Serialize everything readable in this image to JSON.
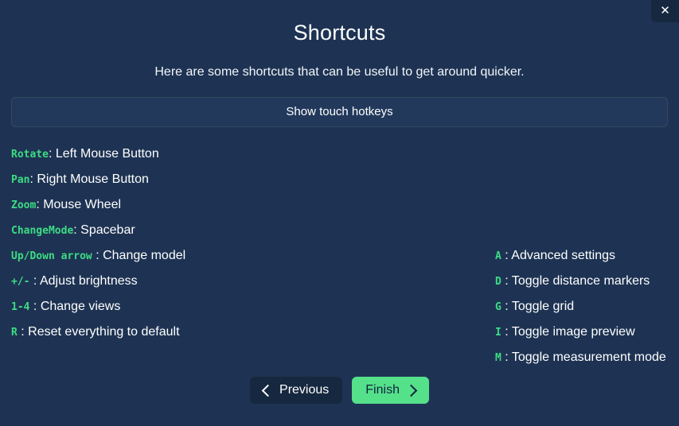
{
  "dialog": {
    "title": "Shortcuts",
    "subtitle": "Here are some shortcuts that can be useful to get around quicker.",
    "close_label": "✕"
  },
  "touch_button": {
    "label": "Show touch hotkeys"
  },
  "colors": {
    "background": "#1e3353",
    "key_green": "#3ddc84",
    "finish_green": "#55e08a",
    "button_dark": "#16283f",
    "panel": "#22395c"
  },
  "shortcuts_left": [
    {
      "key": "Rotate",
      "sep": ": ",
      "desc": "Left Mouse Button"
    },
    {
      "key": "Pan",
      "sep": ": ",
      "desc": "Right Mouse Button"
    },
    {
      "key": "Zoom",
      "sep": ": ",
      "desc": "Mouse Wheel"
    },
    {
      "key": "ChangeMode",
      "sep": ": ",
      "desc": "Spacebar"
    },
    {
      "key": "Up/Down arrow",
      "sep": " : ",
      "desc": "Change model"
    },
    {
      "key": "+/-",
      "sep": " : ",
      "desc": "Adjust brightness"
    },
    {
      "key": "1-4",
      "sep": " : ",
      "desc": "Change views"
    },
    {
      "key": "R",
      "sep": " : ",
      "desc": "Reset everything to default"
    }
  ],
  "shortcuts_right": [
    {
      "key": "A",
      "sep": " : ",
      "desc": "Advanced settings"
    },
    {
      "key": "D",
      "sep": " : ",
      "desc": "Toggle distance markers"
    },
    {
      "key": "G",
      "sep": " : ",
      "desc": "Toggle grid"
    },
    {
      "key": "I",
      "sep": " : ",
      "desc": "Toggle image preview"
    },
    {
      "key": "M",
      "sep": " : ",
      "desc": "Toggle measurement mode"
    }
  ],
  "footer": {
    "previous_label": "Previous",
    "finish_label": "Finish"
  }
}
